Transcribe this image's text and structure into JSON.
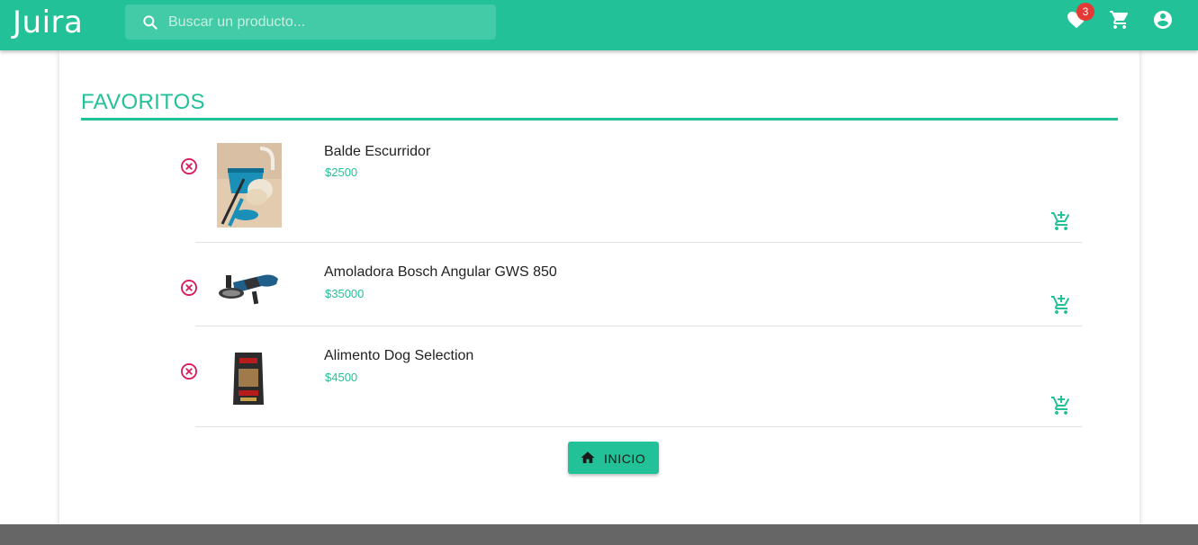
{
  "header": {
    "logo": "Juira",
    "search_placeholder": "Buscar un producto...",
    "favorites_count": "3",
    "accent_color": "#23c197"
  },
  "page": {
    "title": "FAVORITOS"
  },
  "favorites": [
    {
      "name": "Balde Escurridor",
      "price": "$2500",
      "image": "mop-bucket"
    },
    {
      "name": "Amoladora Bosch Angular GWS 850",
      "price": "$35000",
      "image": "angle-grinder"
    },
    {
      "name": "Alimento Dog Selection",
      "price": "$4500",
      "image": "dog-food-bag"
    }
  ],
  "actions": {
    "home_label": "INICIO"
  }
}
